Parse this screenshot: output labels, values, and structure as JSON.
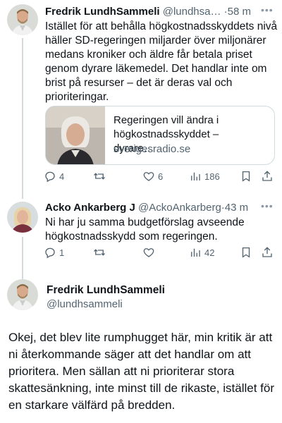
{
  "colors": {
    "text": "#0f1419",
    "muted": "#536471",
    "border": "#cfd9de"
  },
  "tweet1": {
    "author": "Fredrik LundhSammeli",
    "handle": "@lundhsa…",
    "time": "58 m",
    "text": "Istället för att behålla högkostnadsskyddets nivå häller SD-regeringen miljarder över miljonärer medans kroniker och äldre får betala priset genom dyrare läkemedel. Det handlar inte om brist på resurser – det är deras val och prioriteringar.",
    "card": {
      "title": "Regeringen vill ändra i högkostnadsskyddet – dyrare…",
      "domain": "sverigesradio.se"
    },
    "actions": {
      "replies": "4",
      "likes": "6",
      "views": "186"
    }
  },
  "tweet2": {
    "author": "Acko Ankarberg J",
    "handle": "@AckoAnkarberg",
    "time": "43 m",
    "text": "Ni har ju samma budgetförslag avseende högkostnadsskydd som regeringen.",
    "actions": {
      "replies": "1",
      "views": "42"
    }
  },
  "main": {
    "author": "Fredrik LundhSammeli",
    "handle": "@lundhsammeli",
    "text": "Okej, det blev lite rumphugget här, min kritik är att ni återkommande säger att det handlar om att prioritera. Men sällan att ni prioriterar stora skattesänkning, inte minst till de rikaste, istället för en starkare välfärd på bredden."
  },
  "icons": [
    "reply-icon",
    "retweet-icon",
    "like-icon",
    "views-icon",
    "bookmark-icon",
    "share-icon",
    "more-icon"
  ]
}
